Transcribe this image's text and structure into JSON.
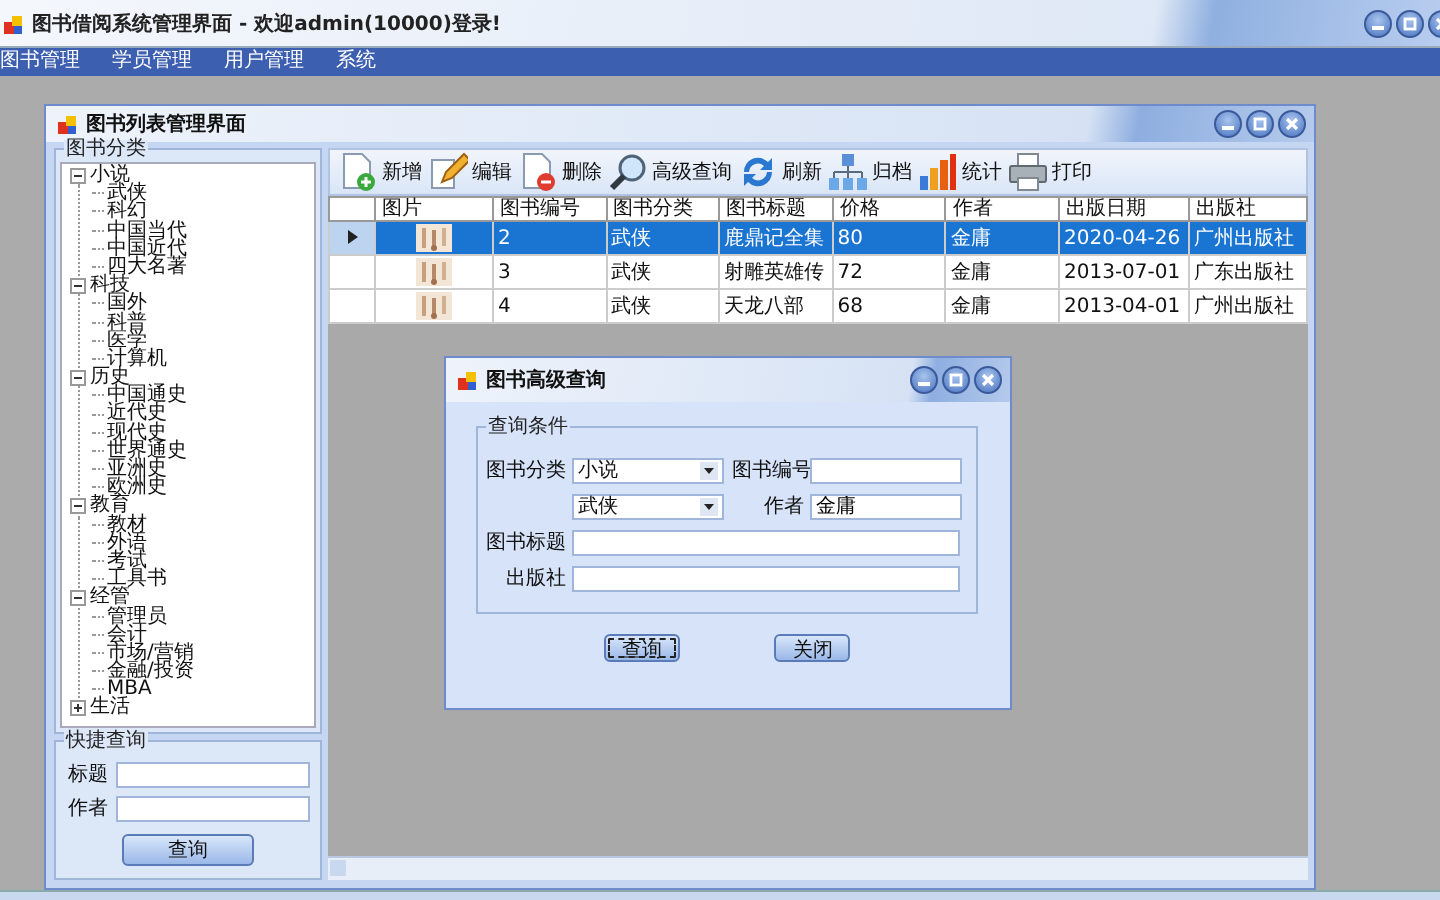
{
  "window": {
    "title": "图书借阅系统管理界面 - 欢迎admin(10000)登录!"
  },
  "menu": [
    {
      "label": "图书管理"
    },
    {
      "label": "学员管理"
    },
    {
      "label": "用户管理"
    },
    {
      "label": "系统"
    }
  ],
  "child_window": {
    "title": "图书列表管理界面"
  },
  "category_tree": {
    "title": "图书分类",
    "nodes": [
      {
        "label": "小说",
        "expanded": true,
        "children": [
          {
            "label": "武侠"
          },
          {
            "label": "科幻"
          },
          {
            "label": "中国当代"
          },
          {
            "label": "中国近代"
          },
          {
            "label": "四大名著"
          }
        ]
      },
      {
        "label": "科技",
        "expanded": true,
        "children": [
          {
            "label": "国外"
          },
          {
            "label": "科普"
          },
          {
            "label": "医学"
          },
          {
            "label": "计算机"
          }
        ]
      },
      {
        "label": "历史",
        "expanded": true,
        "children": [
          {
            "label": "中国通史"
          },
          {
            "label": "近代史"
          },
          {
            "label": "现代史"
          },
          {
            "label": "世界通史"
          },
          {
            "label": "亚洲史"
          },
          {
            "label": "欧洲史"
          }
        ]
      },
      {
        "label": "教育",
        "expanded": true,
        "children": [
          {
            "label": "教材"
          },
          {
            "label": "外语"
          },
          {
            "label": "考试"
          },
          {
            "label": "工具书"
          }
        ]
      },
      {
        "label": "经管",
        "expanded": true,
        "children": [
          {
            "label": "管理员"
          },
          {
            "label": "会计"
          },
          {
            "label": "市场/营销"
          },
          {
            "label": "金融/投资"
          },
          {
            "label": "MBA"
          }
        ]
      },
      {
        "label": "生活",
        "expanded": false
      }
    ]
  },
  "quick_query": {
    "title": "快捷查询",
    "fields": [
      {
        "label": "标题"
      },
      {
        "label": "作者"
      }
    ],
    "button": "查询"
  },
  "toolbar": [
    {
      "label": "新增"
    },
    {
      "label": "编辑"
    },
    {
      "label": "删除"
    },
    {
      "label": "高级查询"
    },
    {
      "label": "刷新"
    },
    {
      "label": "归档"
    },
    {
      "label": "统计"
    },
    {
      "label": "打印"
    }
  ],
  "table": {
    "columns": [
      "",
      "图片",
      "图书编号",
      "图书分类",
      "图书标题",
      "价格",
      "作者",
      "出版日期",
      "出版社"
    ],
    "rows": [
      {
        "selected": true,
        "cells": [
          "",
          "",
          "2",
          "武侠",
          "鹿鼎记全集",
          "80",
          "金庸",
          "2020-04-26",
          "广州出版社"
        ]
      },
      {
        "selected": false,
        "cells": [
          "",
          "",
          "3",
          "武侠",
          "射雕英雄传",
          "72",
          "金庸",
          "2013-07-01",
          "广东出版社"
        ]
      },
      {
        "selected": false,
        "cells": [
          "",
          "",
          "4",
          "武侠",
          "天龙八部",
          "68",
          "金庸",
          "2013-04-01",
          "广州出版社"
        ]
      }
    ]
  },
  "dialog": {
    "title": "图书高级查询",
    "group": "查询条件",
    "rows": [
      [
        {
          "kind": "select",
          "label": "图书分类",
          "value": "小说"
        },
        {
          "kind": "input",
          "label": "图书编号"
        }
      ],
      [
        {
          "kind": "select",
          "value": "武侠"
        },
        {
          "kind": "input",
          "label": "作者",
          "value": "金庸"
        }
      ],
      [
        {
          "kind": "input",
          "label": "图书标题"
        }
      ],
      [
        {
          "kind": "input",
          "label": "出版社"
        }
      ]
    ],
    "buttons": [
      {
        "label": "查询",
        "focused": true
      },
      {
        "label": "关闭",
        "focused": false
      }
    ]
  }
}
